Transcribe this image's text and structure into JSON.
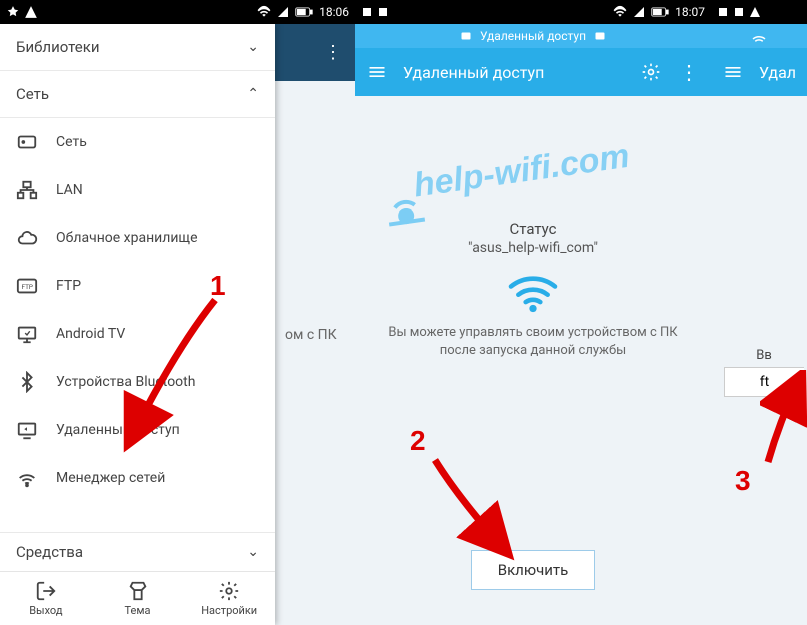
{
  "status_time": "18:06",
  "status_time2": "18:07",
  "status_time3": "18:07",
  "phone1": {
    "bg_text": "ом с ПК",
    "sections": {
      "libraries": "Библиотеки",
      "network": "Сеть",
      "tools": "Средства"
    },
    "items": {
      "net": "Сеть",
      "lan": "LAN",
      "cloud": "Облачное хранилище",
      "ftp": "FTP",
      "atv": "Android TV",
      "bt": "Устройства Bluetooth",
      "remote": "Удаленный доступ",
      "netmgr": "Менеджер сетей"
    },
    "bottom": {
      "exit": "Выход",
      "theme": "Тема",
      "settings": "Настройки"
    }
  },
  "phone2": {
    "notif": "Удаленный доступ",
    "title": "Удаленный доступ",
    "watermark": "help-wifi.com",
    "status_label": "Статус",
    "status_value": "\"asus_help-wifi_com\"",
    "desc": "Вы можете управлять своим устройством с ПК после запуска данной службы",
    "enable": "Включить"
  },
  "phone3": {
    "title": "Удал",
    "hint": "Вв",
    "input": "ft"
  },
  "markers": {
    "m1": "1",
    "m2": "2",
    "m3": "3"
  }
}
